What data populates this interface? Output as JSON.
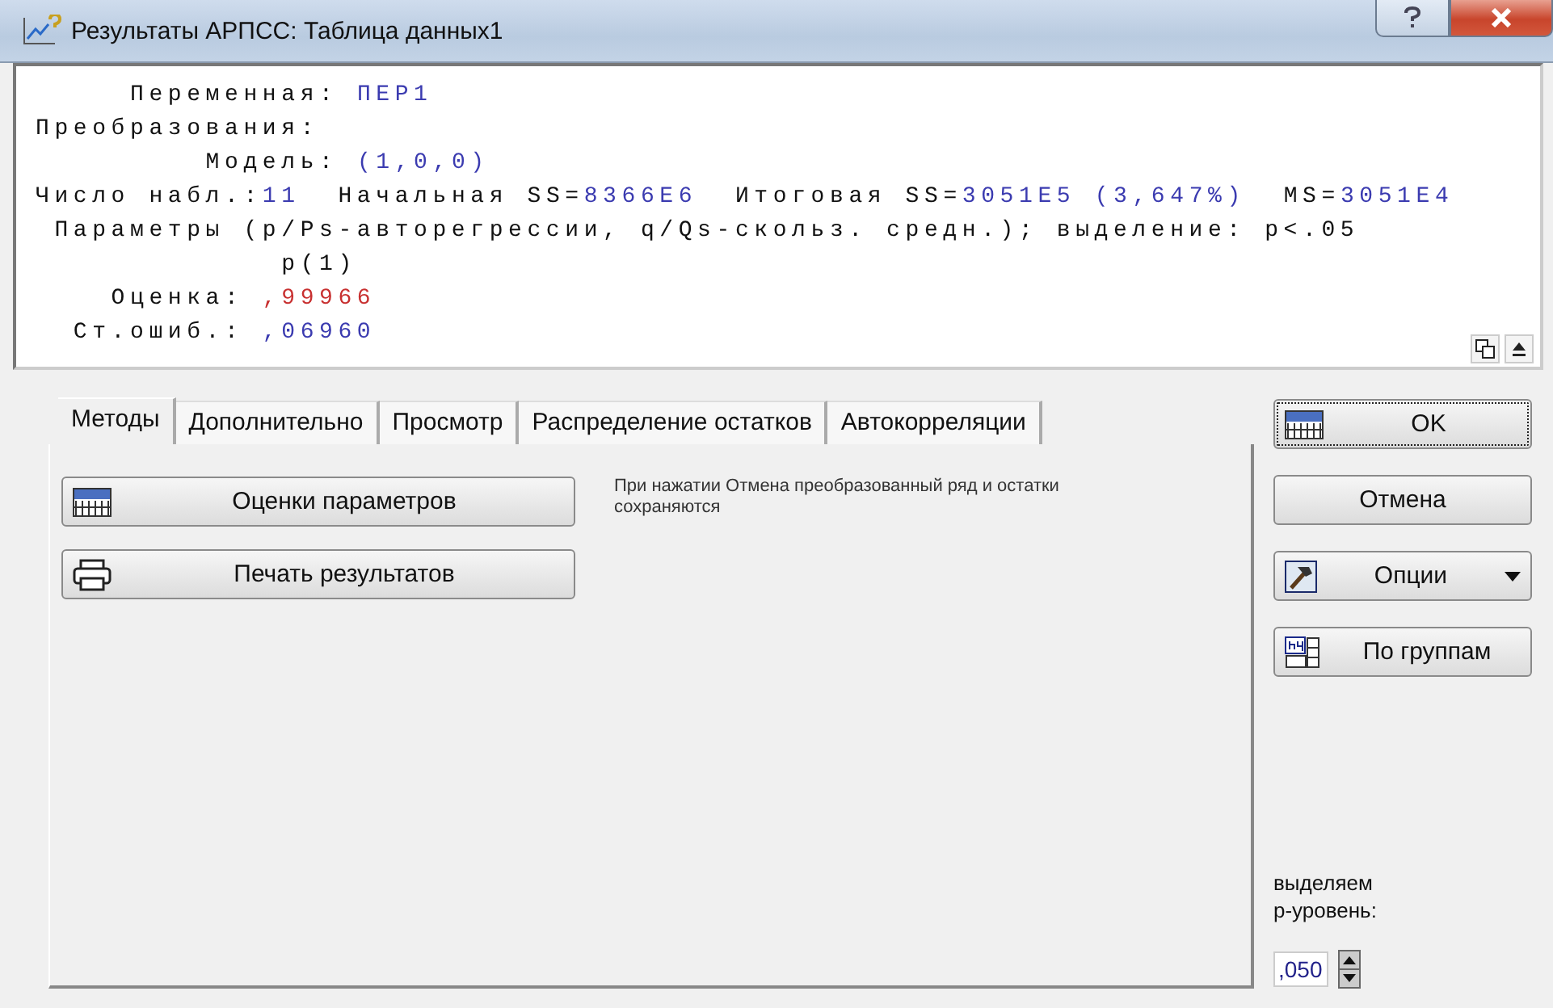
{
  "window": {
    "title": "Результаты АРПСС: Таблица данных1"
  },
  "output": {
    "lines": [
      {
        "segments": [
          {
            "text": "     Переменная: ",
            "color": "#111111"
          },
          {
            "text": "ПЕР1",
            "color": "#3b3bb0"
          }
        ]
      },
      {
        "segments": [
          {
            "text": "Преобразования:",
            "color": "#111111"
          }
        ]
      },
      {
        "segments": [
          {
            "text": "         Модель: ",
            "color": "#111111"
          },
          {
            "text": "(1,0,0)",
            "color": "#3b3bb0"
          }
        ]
      },
      {
        "segments": [
          {
            "text": "Число набл.:",
            "color": "#111111"
          },
          {
            "text": "11",
            "color": "#3b3bb0"
          },
          {
            "text": "  Начальная SS=",
            "color": "#111111"
          },
          {
            "text": "8366E6",
            "color": "#3b3bb0"
          },
          {
            "text": "  Итоговая SS=",
            "color": "#111111"
          },
          {
            "text": "3051E5 (3,647%)",
            "color": "#3b3bb0"
          },
          {
            "text": "  MS=",
            "color": "#111111"
          },
          {
            "text": "3051E4",
            "color": "#3b3bb0"
          }
        ]
      },
      {
        "segments": [
          {
            "text": " Параметры (p/Ps-авторегрессии, q/Qs-скольз. средн.); выделение: p<.05",
            "color": "#111111"
          }
        ]
      },
      {
        "segments": [
          {
            "text": "             p(1)",
            "color": "#111111"
          }
        ]
      },
      {
        "segments": [
          {
            "text": "    Оценка: ",
            "color": "#111111"
          },
          {
            "text": ",99966",
            "color": "#c83030"
          }
        ]
      },
      {
        "segments": [
          {
            "text": "  Ст.ошиб.: ",
            "color": "#111111"
          },
          {
            "text": ",06960",
            "color": "#3b3bb0"
          }
        ]
      }
    ]
  },
  "tabs": [
    {
      "label": "Методы",
      "selected": true
    },
    {
      "label": "Дополнительно",
      "selected": false
    },
    {
      "label": "Просмотр",
      "selected": false
    },
    {
      "label": "Распределение остатков",
      "selected": false
    },
    {
      "label": "Автокорреляции",
      "selected": false
    }
  ],
  "actions": [
    {
      "label": "Оценки параметров",
      "kind": "table"
    },
    {
      "label": "Печать результатов",
      "kind": "printer"
    }
  ],
  "note": "При нажатии Отмена преобразованный ряд и остатки сохраняются",
  "side_buttons": [
    {
      "label": "OK",
      "kind": "table",
      "focused": true
    },
    {
      "label": "Отмена",
      "kind": "plain",
      "focused": false
    },
    {
      "label": "Опции",
      "kind": "menu",
      "focused": false
    },
    {
      "label": "По группам",
      "kind": "groups",
      "focused": false
    }
  ],
  "p_level": {
    "label": "выделяем р-уровень:",
    "value": ",050"
  }
}
